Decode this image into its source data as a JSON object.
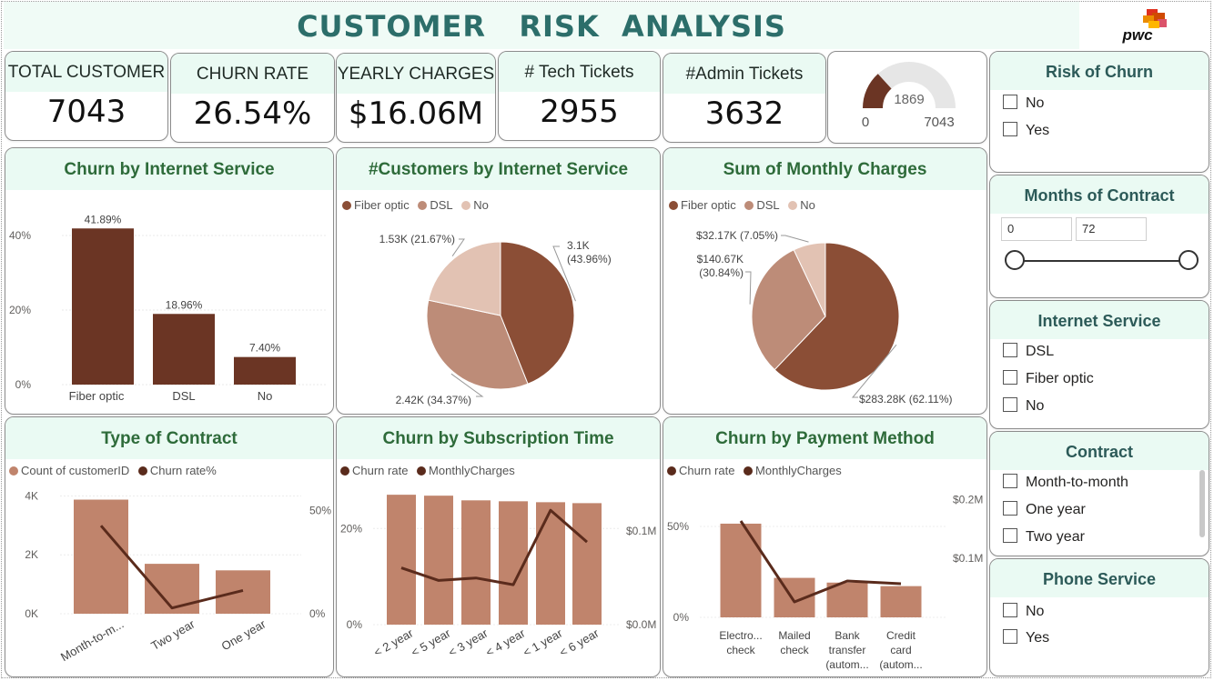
{
  "header": {
    "title": "CUSTOMER   RISK  ANALYSIS",
    "logo_text": "pwc"
  },
  "kpis": [
    {
      "label": "TOTAL CUSTOMER",
      "value": "7043"
    },
    {
      "label": "CHURN RATE",
      "value": "26.54%"
    },
    {
      "label": "YEARLY CHARGES",
      "value": "$16.06M"
    },
    {
      "label": "# Tech Tickets",
      "value": "2955"
    },
    {
      "label": "#Admin Tickets",
      "value": "3632"
    }
  ],
  "gauge": {
    "value": 1869,
    "min": 0,
    "max": 7043,
    "value_label": "1869",
    "min_label": "0",
    "max_label": "7043",
    "fill_color": "#6b3524",
    "track_color": "#e6e6e6"
  },
  "colors": {
    "dark_brown": "#6b3524",
    "bar_tan": "#c0846c",
    "line_brown": "#5a2b1c",
    "fiber": "#8b4e36",
    "dsl": "#bd8c78",
    "no": "#e2c2b3",
    "accent_green": "#2e6b3a",
    "title_teal": "#2c6e6a"
  },
  "panels": {
    "churn_internet": {
      "title": "Churn by Internet Service"
    },
    "customers_internet": {
      "title": "#Customers by Internet Service",
      "legend": [
        "Fiber optic",
        "DSL",
        "No"
      ]
    },
    "monthly_charges": {
      "title": "Sum of Monthly Charges",
      "legend": [
        "Fiber optic",
        "DSL",
        "No"
      ]
    },
    "contract_type": {
      "title": "Type of Contract",
      "legend": [
        "Count of customerID",
        "Churn rate%"
      ]
    },
    "subscription": {
      "title": "Churn by Subscription Time",
      "legend": [
        "Churn rate",
        "MonthlyCharges"
      ]
    },
    "payment": {
      "title": "Churn by Payment Method",
      "legend": [
        "Churn rate",
        "MonthlyCharges"
      ]
    }
  },
  "chart_data": [
    {
      "id": "churn_internet",
      "type": "bar",
      "categories": [
        "Fiber optic",
        "DSL",
        "No"
      ],
      "values": [
        41.89,
        18.96,
        7.4
      ],
      "data_labels": [
        "41.89%",
        "18.96%",
        "7.40%"
      ],
      "yticks": [
        "0%",
        "20%",
        "40%"
      ],
      "ytick_values": [
        0,
        20,
        40
      ],
      "ylim": [
        0,
        50
      ]
    },
    {
      "id": "customers_internet",
      "type": "pie",
      "labels": [
        "Fiber optic",
        "DSL",
        "No"
      ],
      "values": [
        3096,
        2421,
        1526
      ],
      "percent": [
        43.96,
        34.37,
        21.67
      ],
      "data_labels": [
        [
          "3.1K",
          "(43.96%)"
        ],
        [
          "2.42K (34.37%)"
        ],
        [
          "1.53K (21.67%)"
        ]
      ]
    },
    {
      "id": "monthly_charges",
      "type": "pie",
      "labels": [
        "Fiber optic",
        "DSL",
        "No"
      ],
      "values": [
        283.28,
        140.67,
        32.17
      ],
      "percent": [
        62.11,
        30.84,
        7.05
      ],
      "data_labels": [
        [
          "$283.28K (62.11%)"
        ],
        [
          "$140.67K",
          "(30.84%)"
        ],
        [
          "$32.17K (7.05%)"
        ]
      ]
    },
    {
      "id": "contract_type",
      "type": "bar",
      "categories": [
        "Month-to-m...",
        "Two year",
        "One year"
      ],
      "series": [
        {
          "name": "Count of customerID",
          "type": "bar",
          "values": [
            3875,
            1695,
            1473
          ]
        },
        {
          "name": "Churn rate%",
          "type": "line",
          "values": [
            42.7,
            2.8,
            11.3
          ]
        }
      ],
      "y_left_ticks": [
        "0K",
        "2K",
        "4K"
      ],
      "y_left_tick_values": [
        0,
        2000,
        4000
      ],
      "y_left_lim": [
        0,
        4200
      ],
      "y_right_ticks": [
        "0%",
        "50%"
      ],
      "y_right_tick_values": [
        0,
        50
      ],
      "y_right_lim": [
        0,
        60
      ]
    },
    {
      "id": "subscription",
      "type": "bar",
      "categories": [
        "< 2 year",
        "< 5 year",
        "< 3 year",
        "< 4 year",
        "< 1 year",
        "< 6 year"
      ],
      "series": [
        {
          "name": "Churn rate",
          "type": "line",
          "values": [
            11.8,
            9.2,
            9.7,
            8.3,
            23.8,
            17.2
          ]
        },
        {
          "name": "MonthlyCharges",
          "type": "bar",
          "values": [
            0.139,
            0.138,
            0.133,
            0.132,
            0.131,
            0.13
          ]
        }
      ],
      "y_left_ticks": [
        "0%",
        "20%"
      ],
      "y_left_tick_values": [
        0,
        20
      ],
      "y_left_lim": [
        0,
        28
      ],
      "y_right_ticks": [
        "$0.0M",
        "$0.1M"
      ],
      "y_right_tick_values": [
        0,
        0.1
      ],
      "y_right_lim": [
        0,
        0.144
      ]
    },
    {
      "id": "payment",
      "type": "bar",
      "categories": [
        [
          "Electro...",
          "check"
        ],
        [
          "Mailed",
          "check"
        ],
        [
          "Bank",
          "transfer",
          "(autom..."
        ],
        [
          "Credit",
          "card",
          "(autom..."
        ]
      ],
      "series": [
        {
          "name": "Churn rate",
          "type": "line",
          "values": [
            53,
            8.5,
            20,
            18.5
          ]
        },
        {
          "name": "MonthlyCharges",
          "type": "bar",
          "values": [
            0.159,
            0.067,
            0.059,
            0.053
          ]
        }
      ],
      "y_left_ticks": [
        "0%",
        "50%"
      ],
      "y_left_tick_values": [
        0,
        50
      ],
      "y_left_lim": [
        0,
        70
      ],
      "y_right_ticks": [
        "$0.1M",
        "$0.2M"
      ],
      "y_right_tick_values": [
        0.1,
        0.2
      ],
      "y_right_lim": [
        0,
        0.216
      ]
    }
  ],
  "slicers": [
    {
      "title": "Risk of Churn",
      "items": [
        "No",
        "Yes"
      ]
    },
    {
      "title": "Months of Contract",
      "min": "0",
      "max": "72"
    },
    {
      "title": "Internet Service",
      "items": [
        "DSL",
        "Fiber optic",
        "No"
      ]
    },
    {
      "title": "Contract",
      "items": [
        "Month-to-month",
        "One year",
        "Two year"
      ]
    },
    {
      "title": "Phone Service",
      "items": [
        "No",
        "Yes"
      ]
    }
  ]
}
